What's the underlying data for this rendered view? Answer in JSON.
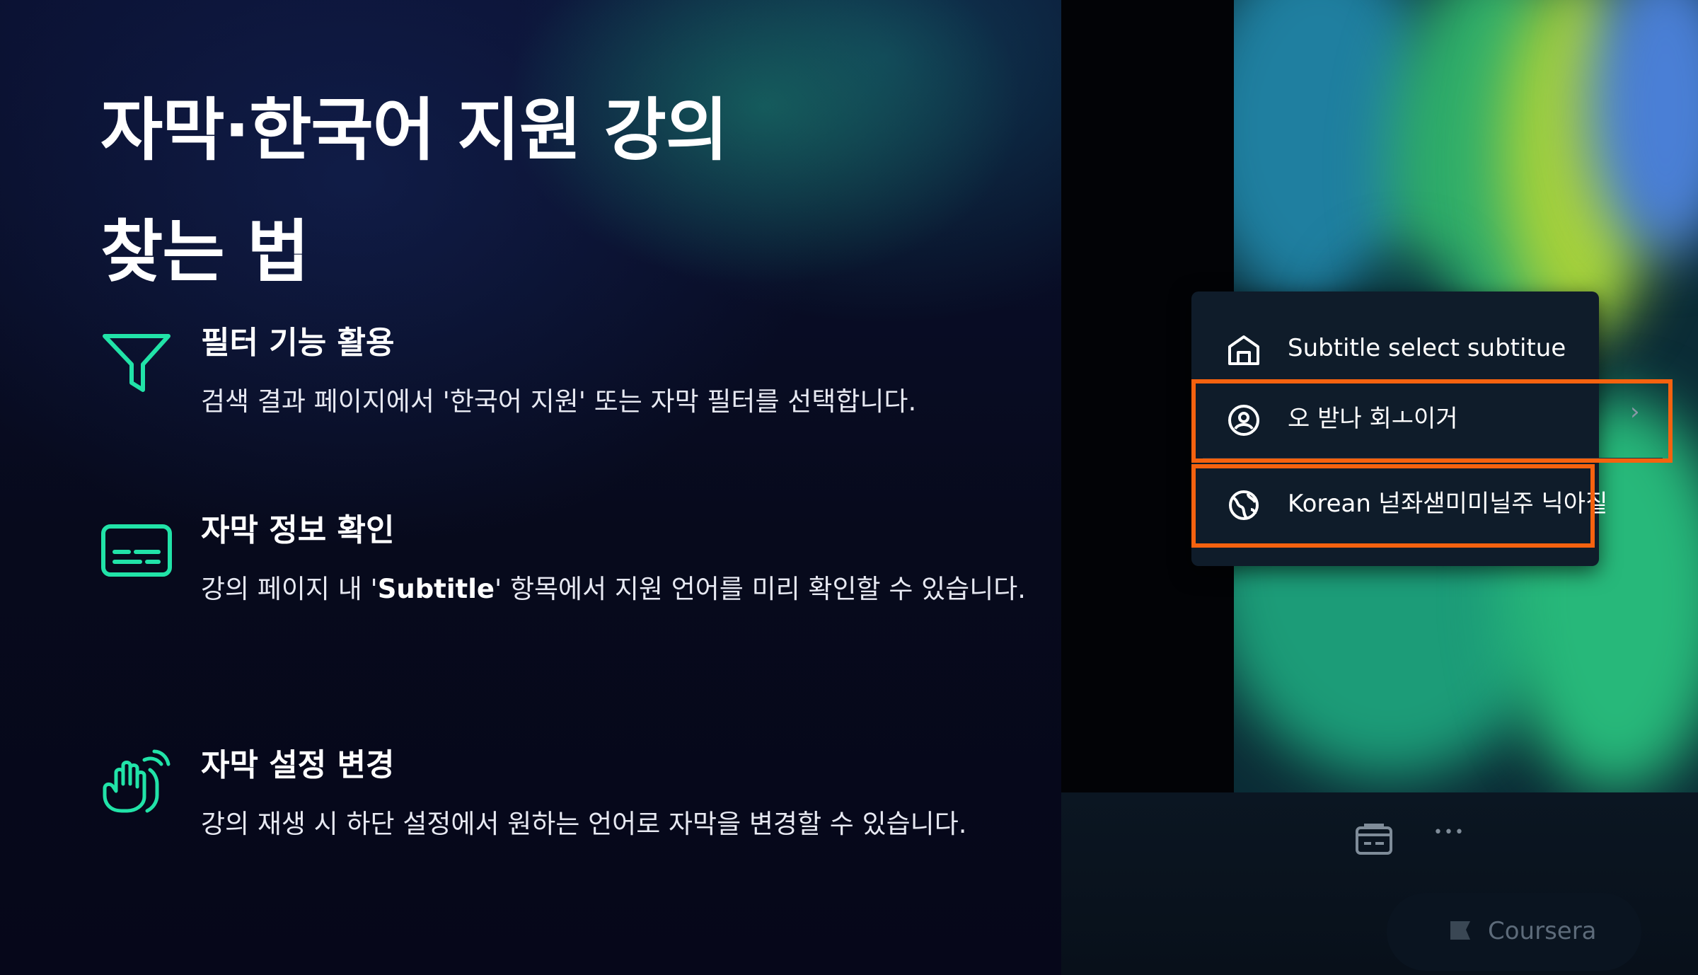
{
  "slide": {
    "title_line1": "자막·한국어 지원 강의",
    "title_line2": "찾는 법",
    "features": [
      {
        "icon": "filter-icon",
        "title": "필터 기능 활용",
        "description": "검색 결과 페이지에서 '한국어 지원' 또는 자막 필터를 선택합니다."
      },
      {
        "icon": "subtitles-icon",
        "title": "자막 정보 확인",
        "description_pre": "강의 페이지 내 '",
        "description_bold": "Subtitle",
        "description_post": "' 항목에서 지원 언어를 미리 확인할 수 있습니다."
      },
      {
        "icon": "hand-gesture-icon",
        "title": "자막 설정 변경",
        "description": "강의 재생 시 하단 설정에서 원하는 언어로 자막을 변경할 수 있습니다."
      }
    ],
    "accent_color": "#21e3a8",
    "highlight_color": "#f5620f"
  },
  "player": {
    "menu": {
      "header": {
        "icon": "home-icon",
        "label": "Subtitle select subtitue"
      },
      "items": [
        {
          "icon": "user-circle-icon",
          "label": "오 받나 회ㅗ이거",
          "chevron": "›"
        },
        {
          "icon": "globe-icon",
          "label": "Korean 넏좌샏미미닐주 닉아짙"
        }
      ]
    },
    "controls": {
      "settings_icon": "caption-settings-icon",
      "more_label": "•••"
    },
    "brand": {
      "icon": "flag-icon",
      "label": "Coursera"
    }
  }
}
